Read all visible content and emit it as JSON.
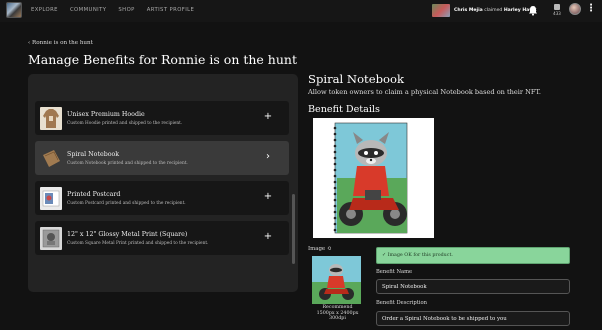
{
  "nav": {
    "items": [
      "EXPLORE",
      "COMMUNITY",
      "SHOP",
      "ARTIST PROFILE"
    ]
  },
  "notification": {
    "user": "Chris Mejia",
    "action": "claimed",
    "item": "Harley Hawk"
  },
  "wallet": {
    "count": "433"
  },
  "breadcrumb": {
    "label": "Ronnie is on the hunt"
  },
  "page": {
    "title": "Manage Benefits for Ronnie is on the hunt"
  },
  "benefits": [
    {
      "name": "Unisex Premium Hoodie",
      "desc": "Custom Hoodie printed and shipped to the recipient.",
      "action": "+"
    },
    {
      "name": "Spiral Notebook",
      "desc": "Custom Notebook printed and shipped to the recipient.",
      "action": "›"
    },
    {
      "name": "Printed Postcard",
      "desc": "Custom Postcard printed and shipped to the recipient.",
      "action": "+"
    },
    {
      "name": "12\" x 12\" Glossy Metal Print (Square)",
      "desc": "Custom Square Metal Print printed and shipped to the recipient.",
      "action": "+"
    }
  ],
  "detail": {
    "title": "Spiral Notebook",
    "subtitle": "Allow token owners to claim a physical Notebook based on their NFT.",
    "section": "Benefit Details",
    "image_label": "Image",
    "image_ok": "Image OK for this product.",
    "recommend": [
      "Recommend",
      "1500px x 2400px",
      "300dpi"
    ],
    "name_label": "Benefit Name",
    "name_value": "Spiral Notebook",
    "desc_label": "Benefit Description",
    "desc_value": "Order a Spiral Notebook to be shipped to you"
  }
}
